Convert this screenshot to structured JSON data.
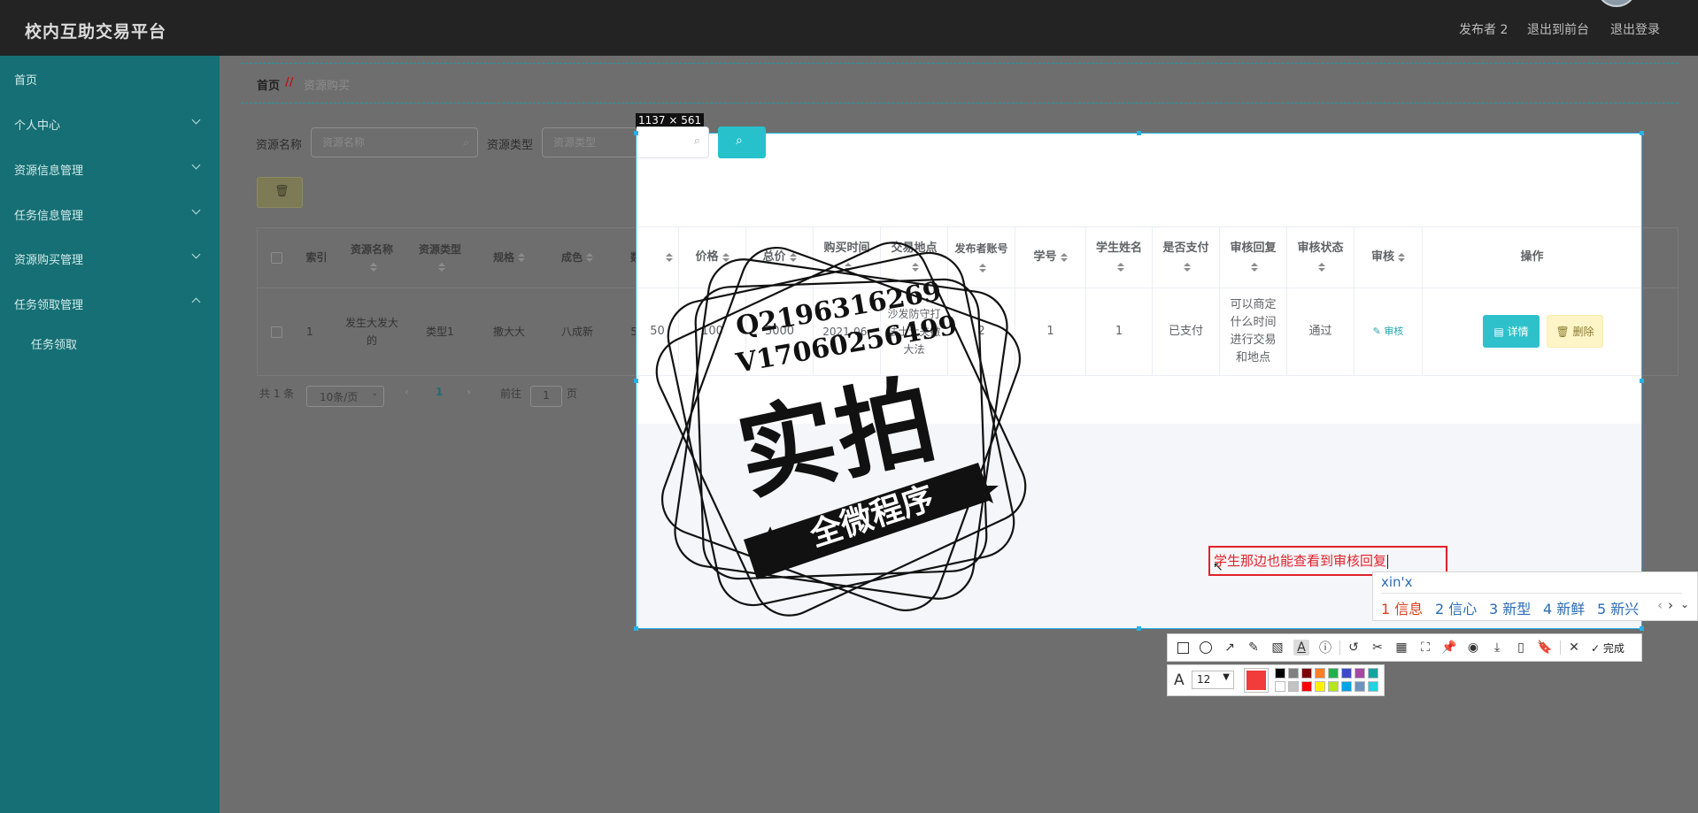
{
  "header": {
    "title": "校内互助交易平台",
    "user_label": "发布者 2",
    "links": [
      "退出到前台",
      "退出登录"
    ]
  },
  "sidebar": {
    "items": [
      {
        "label": "首页",
        "expandable": false
      },
      {
        "label": "个人中心",
        "expandable": true
      },
      {
        "label": "资源信息管理",
        "expandable": true
      },
      {
        "label": "任务信息管理",
        "expandable": true
      },
      {
        "label": "资源购买管理",
        "expandable": true
      },
      {
        "label": "任务领取管理",
        "expandable": true,
        "expanded": true
      }
    ],
    "subitems": [
      "任务领取"
    ]
  },
  "breadcrumb": {
    "home": "首页",
    "separator": "//",
    "current": "资源购买"
  },
  "filters": {
    "name_label": "资源名称",
    "name_placeholder": "资源名称",
    "type_label": "资源类型",
    "type_placeholder": "资源类型"
  },
  "table": {
    "columns": [
      "索引",
      "资源名称",
      "资源类型",
      "规格",
      "成色",
      "数量",
      "价格",
      "总价",
      "购买时间",
      "交易地点",
      "发布者账号",
      "学号",
      "学生姓名",
      "是否支付",
      "审核回复",
      "审核状态",
      "审核",
      "操作"
    ],
    "row": {
      "index": "1",
      "name": "发生大发大的",
      "type": "类型1",
      "spec": "撒大大",
      "condition": "八成新",
      "quantity": "50",
      "price": "100",
      "total": "5000",
      "time": "2021-06-",
      "place": "沙发防守打法士大夫撒大法",
      "publisher": "2",
      "student_no": "1",
      "student_name": "1",
      "paid": "已支付",
      "reply": "可以商定什么时间进行交易和地点",
      "status": "通过",
      "review_label": "审核",
      "detail_label": "详情",
      "delete_label": "删除"
    }
  },
  "pagination": {
    "total": "共 1 条",
    "page_size": "10条/页",
    "current": "1",
    "goto_label": "前往",
    "goto_value": "1",
    "page_suffix": "页"
  },
  "screenshot_tool": {
    "size_label": "1137 × 561",
    "annotation_text": "学生那边也能查看到审核回复",
    "ime_input": "xin'x",
    "ime_candidates": [
      "1 信息",
      "2 信心",
      "3 新型",
      "4 新鲜",
      "5 新兴"
    ],
    "done_label": "完成",
    "font_size": "12",
    "current_color": "#f23b3b",
    "palette": [
      "#000000",
      "#808080",
      "#800000",
      "#ff7f27",
      "#22b14c",
      "#3f48cc",
      "#a349a4",
      "#17a2a2",
      "#ffffff",
      "#c3c3c3",
      "#ff0000",
      "#fff200",
      "#b5e61d",
      "#00a2e8",
      "#7092be",
      "#24d2e0"
    ]
  },
  "watermark": {
    "line1": "Q2196316269",
    "line2": "V17060256499",
    "main": "实拍",
    "banner": "全微程序"
  },
  "colors": {
    "topbar": "#232323",
    "sidebar": "#166f74",
    "accent": "#27c1cc",
    "annotation": "#e0222a"
  }
}
